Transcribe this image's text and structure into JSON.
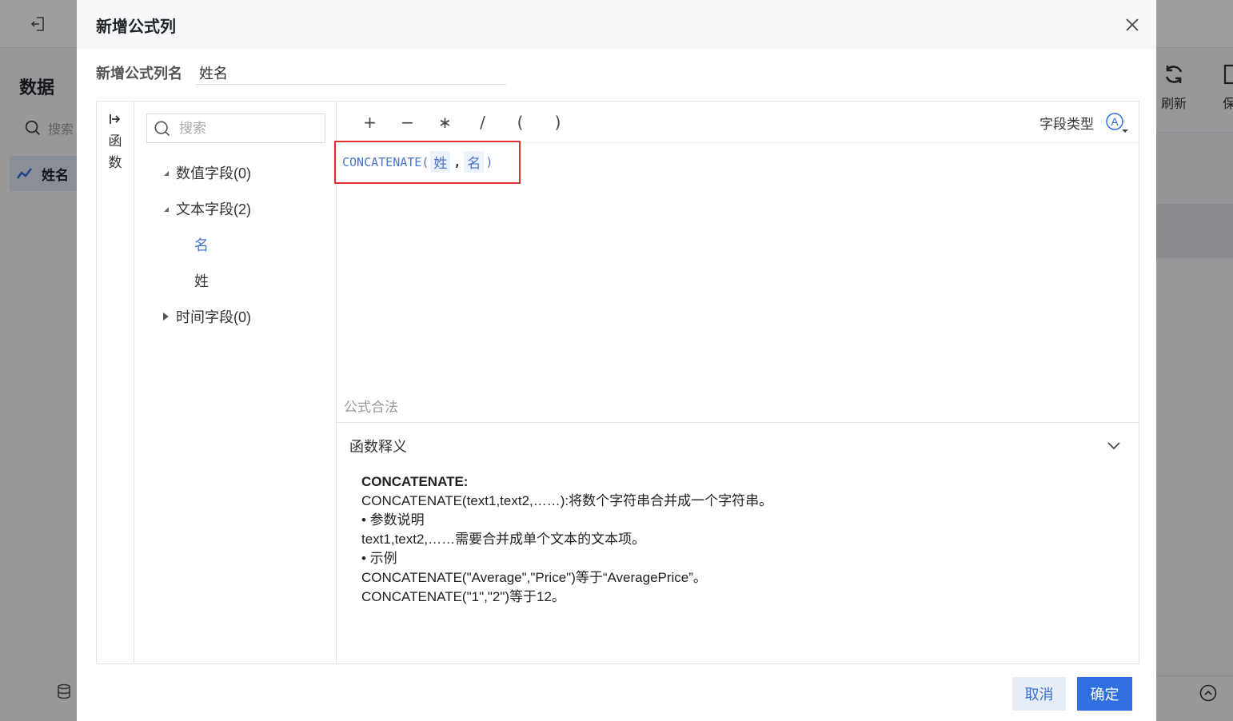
{
  "background": {
    "title": "数据",
    "search_placeholder": "搜索",
    "selected_item": "姓名",
    "tools": {
      "refresh": "刷新",
      "save": "保"
    }
  },
  "dialog": {
    "title": "新增公式列",
    "name_label": "新增公式列名",
    "name_value": "姓名",
    "sidebar_label_1": "函",
    "sidebar_label_2": "数",
    "search_placeholder": "搜索",
    "tree": [
      {
        "label": "数值字段(0)",
        "expanded": false,
        "children": []
      },
      {
        "label": "文本字段(2)",
        "expanded": true,
        "children": [
          "名",
          "姓"
        ]
      },
      {
        "label": "时间字段(0)",
        "expanded": false,
        "children": []
      }
    ],
    "operators": [
      "+",
      "−",
      "∗",
      "/",
      "(",
      ")"
    ],
    "field_type_label": "字段类型",
    "field_type_icon": "A",
    "formula": {
      "function": "CONCATENATE",
      "open": "(",
      "arg1": "姓",
      "sep": ",",
      "arg2": "名",
      "close": ")"
    },
    "validity": "公式合法",
    "explain": {
      "header": "函数释义",
      "lines": [
        "CONCATENATE:",
        "CONCATENATE(text1,text2,……):将数个字符串合并成一个字符串。",
        "• 参数说明",
        "text1,text2,……需要合并成单个文本的文本项。",
        "• 示例",
        "CONCATENATE(\"Average\",\"Price\")等于“AveragePrice”。",
        "CONCATENATE(\"1\",\"2\")等于12。"
      ]
    },
    "buttons": {
      "cancel": "取消",
      "ok": "确定"
    }
  },
  "colors": {
    "accent": "#2f6fe0",
    "link": "#4a74c9",
    "highlight_border": "#e0312b"
  }
}
